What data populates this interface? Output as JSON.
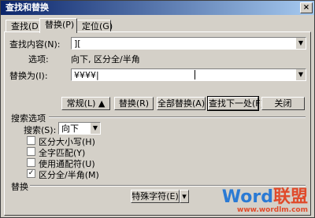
{
  "window": {
    "title": "查找和替换",
    "close_label": "×"
  },
  "tabs": [
    {
      "label": "查找(D)"
    },
    {
      "label": "替换(P)"
    },
    {
      "label": "定位(G)"
    }
  ],
  "find": {
    "label": "查找内容(N):",
    "value": "][",
    "options_label": "选项:",
    "options_value": "向下, 区分全/半角"
  },
  "replace": {
    "label": "替换为(I):",
    "value": "¥¥¥¥|"
  },
  "buttons": {
    "more": "常规(L) ▲",
    "replace": "替换(R)",
    "replace_all": "全部替换(A)",
    "find_next": "查找下一处(F)",
    "close": "关闭"
  },
  "search_options": {
    "title": "搜索选项",
    "search_label": "搜索(S):",
    "search_value": "向下",
    "checkboxes": [
      {
        "label": "区分大小写(H)",
        "checked": false
      },
      {
        "label": "全字匹配(Y)",
        "checked": false
      },
      {
        "label": "使用通配符(U)",
        "checked": false
      },
      {
        "label": "区分全/半角(M)",
        "checked": true
      }
    ]
  },
  "replace_section": {
    "title": "替换",
    "special_char": "特殊字符(E)"
  },
  "watermark": {
    "word": "Word",
    "cn": "联盟",
    "url": "www.wordlm.com"
  },
  "icons": {
    "dropdown": "▼",
    "check": "✓",
    "split": "▾"
  }
}
